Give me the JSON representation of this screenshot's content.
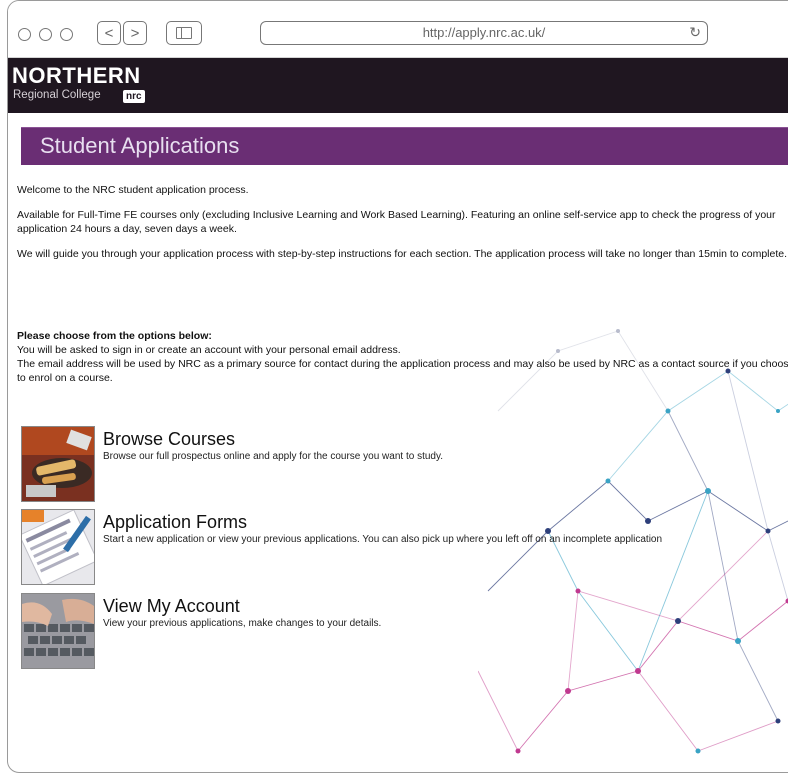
{
  "browser": {
    "url": "http://apply.nrc.ac.uk/",
    "back_glyph": "<",
    "forward_glyph": ">",
    "reload_glyph": "↻"
  },
  "header": {
    "logo_main": "NORTHERN",
    "logo_sub": "Regional College",
    "logo_badge": "nrc"
  },
  "page": {
    "title": "Student Applications",
    "paragraphs": [
      "Welcome to the NRC student application process.",
      "Available for Full-Time FE courses only (excluding Inclusive Learning and Work Based Learning). Featuring an online self-service app to check the progress of your application 24 hours a day, seven days a week.",
      "We will guide you through your application process with step-by-step instructions for each section. The application process will take no longer than 15min to complete."
    ],
    "options_heading": "Please choose from the options below:",
    "options_note_1": "You will be asked to sign in or create an account with your personal email address.",
    "options_note_2": "The email address will be used by NRC as a primary source for contact during the application process and may also be used by NRC as a contact source if you choose to enrol on a course."
  },
  "options": [
    {
      "title": "Browse Courses",
      "description": "Browse our full prospectus online and apply for the course you want to study."
    },
    {
      "title": "Application Forms",
      "description": "Start a new application or view your previous applications. You can also pick up where you left off on an incomplete application"
    },
    {
      "title": "View My Account",
      "description": "View your previous applications, make changes to your details."
    }
  ],
  "colors": {
    "header_bg": "#1f1620",
    "title_bar": "#6a2e74",
    "network_pink": "#c0398f",
    "network_teal": "#3aa3c4",
    "network_navy": "#2d3f7a"
  }
}
